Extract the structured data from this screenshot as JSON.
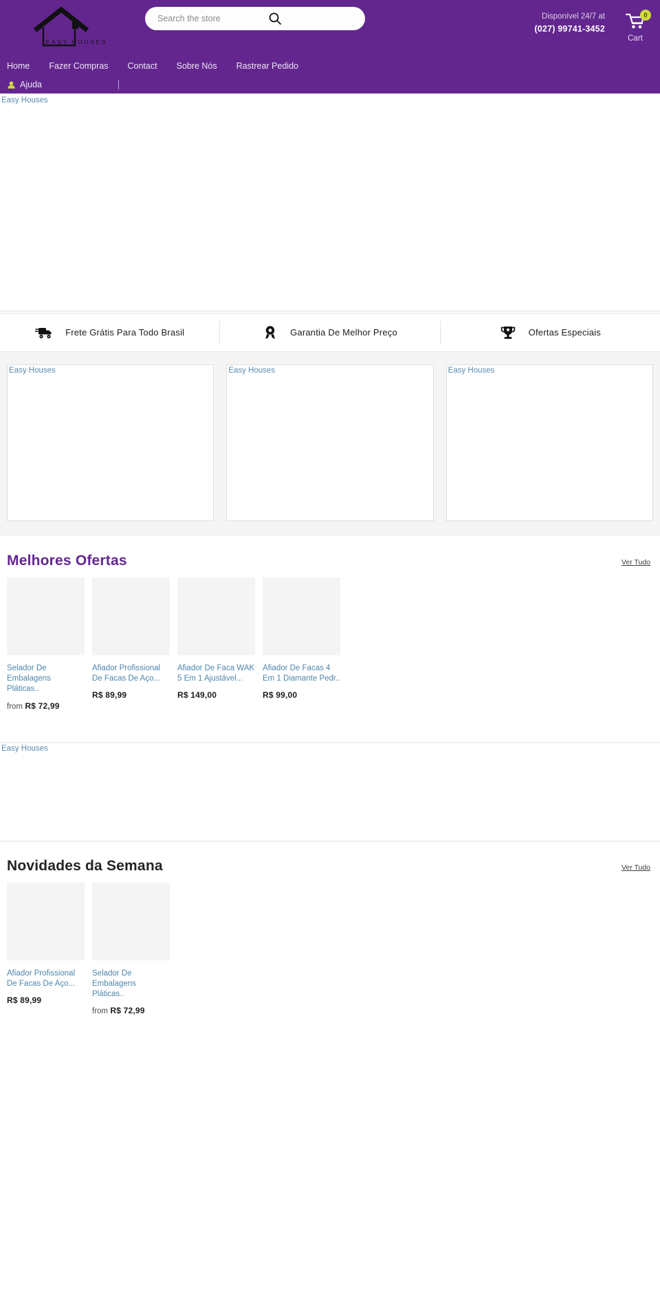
{
  "header": {
    "logo_text": "EASY HOUSES",
    "search": {
      "placeholder": "Search the store",
      "value": "",
      "icon": "search-icon"
    },
    "contact": {
      "availability": "Disponível 24/7 at",
      "phone": "(027) 99741-3452"
    },
    "cart": {
      "label": "Cart",
      "count": "0",
      "icon": "shopping-cart-icon"
    },
    "nav": [
      {
        "label": "Home"
      },
      {
        "label": "Fazer Compras"
      },
      {
        "label": "Contact"
      },
      {
        "label": "Sobre Nós"
      },
      {
        "label": "Rastrear Pedido"
      }
    ],
    "subnav": [
      {
        "label": "Ajuda",
        "icon": "help-agent-icon"
      }
    ]
  },
  "hero": {
    "alt": "Easy Houses"
  },
  "services": [
    {
      "label": "Frete Grátis Para Todo Brasil",
      "icon": "truck-icon"
    },
    {
      "label": "Garantia De Melhor Preço",
      "icon": "award-ribbon-icon"
    },
    {
      "label": "Ofertas Especiais",
      "icon": "trophy-icon"
    }
  ],
  "promos": [
    {
      "alt": "Easy Houses"
    },
    {
      "alt": "Easy Houses"
    },
    {
      "alt": "Easy Houses"
    }
  ],
  "sections": [
    {
      "title": "Melhores Ofertas",
      "see_all": "Ver Tudo",
      "products": [
        {
          "title": "Selador De Embalagens Pláticas..",
          "price_prefix": "from",
          "price": "R$ 72,99"
        },
        {
          "title": "Afiador Profissional De Facas De Aço...",
          "price_prefix": "",
          "price": "R$ 89,99"
        },
        {
          "title": "Afiador De Faca WAK 5 Em 1 Ajustável...",
          "price_prefix": "",
          "price": "R$ 149,00"
        },
        {
          "title": "Afiador De Facas 4 Em 1 Diamante Pedr..",
          "price_prefix": "",
          "price": "R$ 99,00"
        }
      ]
    },
    {
      "title": "Novidades da Semana",
      "see_all": "Ver Tudo",
      "products": [
        {
          "title": "Afiador Profissional De Facas De Aço...",
          "price_prefix": "",
          "price": "R$ 89,99"
        },
        {
          "title": "Selador De Embalagens Pláticas..",
          "price_prefix": "from",
          "price": "R$ 72,99"
        }
      ]
    }
  ],
  "mid_banner": {
    "alt": "Easy Houses"
  },
  "colors": {
    "brand_purple": "#63268f",
    "badge_green": "#cddc39",
    "link_blue": "#4d86ab"
  }
}
